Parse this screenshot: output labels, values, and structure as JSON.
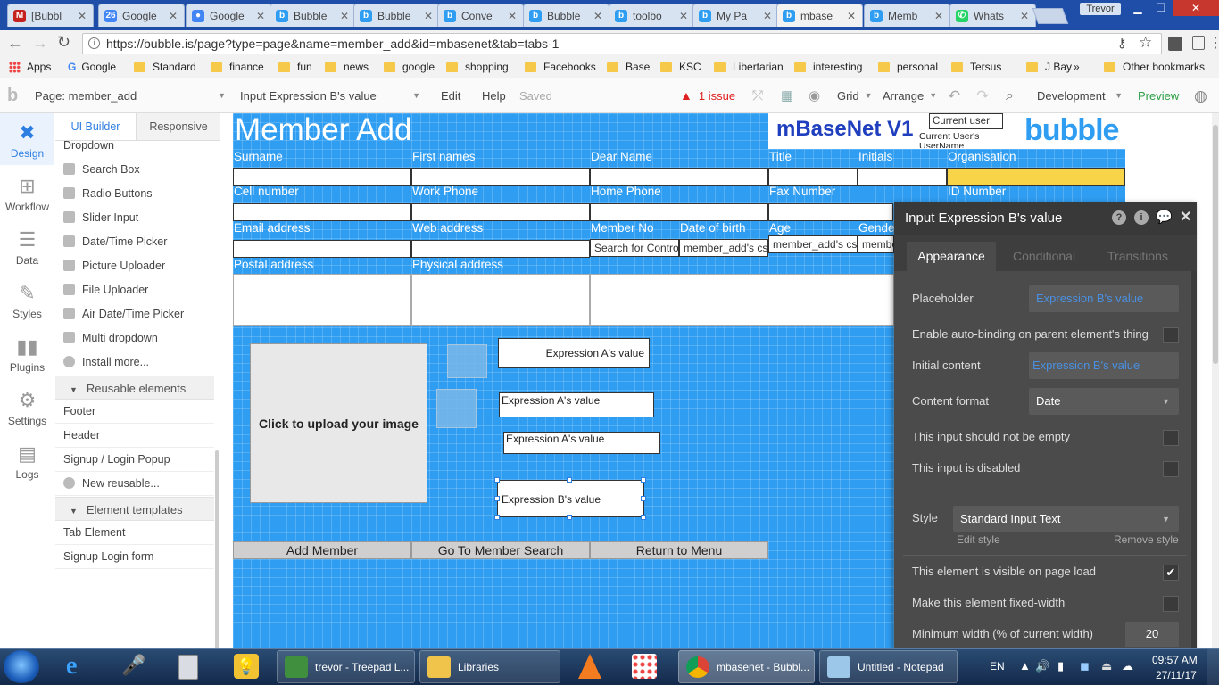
{
  "browser": {
    "tabs": [
      {
        "title": "[Bubbl",
        "icon": "gmail-icon",
        "color": "#c5221f",
        "glyph": "M"
      },
      {
        "title": "Google",
        "icon": "calendar-icon",
        "color": "#4285f4",
        "glyph": "26"
      },
      {
        "title": "Google",
        "icon": "google-account-icon",
        "color": "#4285f4",
        "glyph": "●"
      },
      {
        "title": "Bubble",
        "icon": "bubble-icon",
        "color": "#2f9df1",
        "glyph": "b"
      },
      {
        "title": "Bubble",
        "icon": "bubble-icon",
        "color": "#2f9df1",
        "glyph": "b"
      },
      {
        "title": "Conve",
        "icon": "bubble-icon",
        "color": "#2f9df1",
        "glyph": "b"
      },
      {
        "title": "Bubble",
        "icon": "bubble-icon",
        "color": "#2f9df1",
        "glyph": "b"
      },
      {
        "title": "toolbo",
        "icon": "bubble-icon",
        "color": "#2f9df1",
        "glyph": "b"
      },
      {
        "title": "My Pa",
        "icon": "bubble-icon",
        "color": "#2f9df1",
        "glyph": "b"
      },
      {
        "title": "mbase",
        "icon": "bubble-icon",
        "color": "#2f9df1",
        "glyph": "b",
        "active": true
      },
      {
        "title": "Memb",
        "icon": "bubble-icon",
        "color": "#2f9df1",
        "glyph": "b"
      },
      {
        "title": "Whats",
        "icon": "whatsapp-icon",
        "color": "#25d366",
        "glyph": "✆"
      }
    ],
    "user": "Trevor",
    "url": "https://bubble.is/page?type=page&name=member_add&id=mbasenet&tab=tabs-1",
    "bookmarks": [
      "Apps",
      "Google",
      "Standard",
      "finance",
      "fun",
      "news",
      "google",
      "shopping",
      "Facebooks",
      "Base",
      "KSC",
      "Libertarian",
      "interesting",
      "personal",
      "Tersus",
      "J Bay"
    ],
    "overflow": "»",
    "other_bookmarks": "Other bookmarks"
  },
  "editor": {
    "page_selector": "Page: member_add",
    "element_selector": "Input Expression B's value",
    "menu": {
      "edit": "Edit",
      "help": "Help",
      "saved": "Saved"
    },
    "issue": "1 issue",
    "grid": "Grid",
    "arrange": "Arrange",
    "env": "Development",
    "preview": "Preview"
  },
  "rail": [
    {
      "label": "Design",
      "icon": "design-icon",
      "active": true
    },
    {
      "label": "Workflow",
      "icon": "workflow-icon"
    },
    {
      "label": "Data",
      "icon": "data-icon"
    },
    {
      "label": "Styles",
      "icon": "styles-icon"
    },
    {
      "label": "Plugins",
      "icon": "plugins-icon"
    },
    {
      "label": "Settings",
      "icon": "settings-icon"
    },
    {
      "label": "Logs",
      "icon": "logs-icon"
    }
  ],
  "palette": {
    "tabs": [
      "UI Builder",
      "Responsive"
    ],
    "items": [
      "Dropdown",
      "Search Box",
      "Radio Buttons",
      "Slider Input",
      "Date/Time Picker",
      "Picture Uploader",
      "File Uploader",
      "Air Date/Time Picker",
      "Multi dropdown",
      "Install more..."
    ],
    "reusable_header": "Reusable elements",
    "reusable": [
      "Footer",
      "Header",
      "Signup / Login Popup",
      "New reusable..."
    ],
    "templates_header": "Element templates",
    "templates": [
      "Tab Element",
      "Signup Login form"
    ]
  },
  "canvas": {
    "title": "Member Add",
    "brand": "mBaseNet V1",
    "current_user": "Current user",
    "current_user_name": "Current User's UserName",
    "logo": "bubble",
    "row1": [
      "Surname",
      "First names",
      "Dear Name",
      "Title",
      "Initials",
      "Organisation"
    ],
    "row2": [
      "Cell number",
      "Work Phone",
      "Home Phone",
      "Fax Number",
      "ID Number"
    ],
    "row3": [
      "Email address",
      "Web address",
      "Member No",
      "Date of birth",
      "Age",
      "Gende"
    ],
    "row3_values": [
      "Search for Contro",
      "member_add's cs",
      "member_add's cs...",
      "membe"
    ],
    "row4": [
      "Postal address",
      "Physical address"
    ],
    "upload": "Click to upload your image",
    "expr_a": "Expression A's value",
    "expr_b": "Expression B's value",
    "buttons": [
      "Add Member",
      "Go To Member Search",
      "Return to Menu"
    ]
  },
  "panel": {
    "title": "Input Expression B's value",
    "tabs": [
      "Appearance",
      "Conditional",
      "Transitions"
    ],
    "placeholder_label": "Placeholder",
    "placeholder_value": "Expression B's value",
    "autobind_label": "Enable auto-binding on parent element's thing",
    "initial_label": "Initial content",
    "initial_value": "Expression B's value",
    "format_label": "Content format",
    "format_value": "Date",
    "notempty_label": "This input should not be empty",
    "disabled_label": "This input is disabled",
    "style_label": "Style",
    "style_value": "Standard Input Text",
    "edit_style": "Edit style",
    "remove_style": "Remove style",
    "visible_label": "This element is visible on page load",
    "visible_checked": true,
    "fixed_label": "Make this element fixed-width",
    "minwidth_label": "Minimum width (% of current width)",
    "minwidth_value": "20"
  },
  "taskbar": {
    "items": [
      "trevor - Treepad L...",
      "Libraries",
      "mbasenet - Bubbl...",
      "Untitled - Notepad"
    ],
    "lang": "EN",
    "time": "09:57 AM",
    "date": "27/11/17"
  },
  "colors": {
    "canvas_blue": "#2f9df1",
    "panel_dark": "#4b4b4b",
    "link_blue": "#4a90e2",
    "issue_red": "#e02020",
    "preview_green": "#2c9f45",
    "org_yellow": "#f8d548"
  }
}
